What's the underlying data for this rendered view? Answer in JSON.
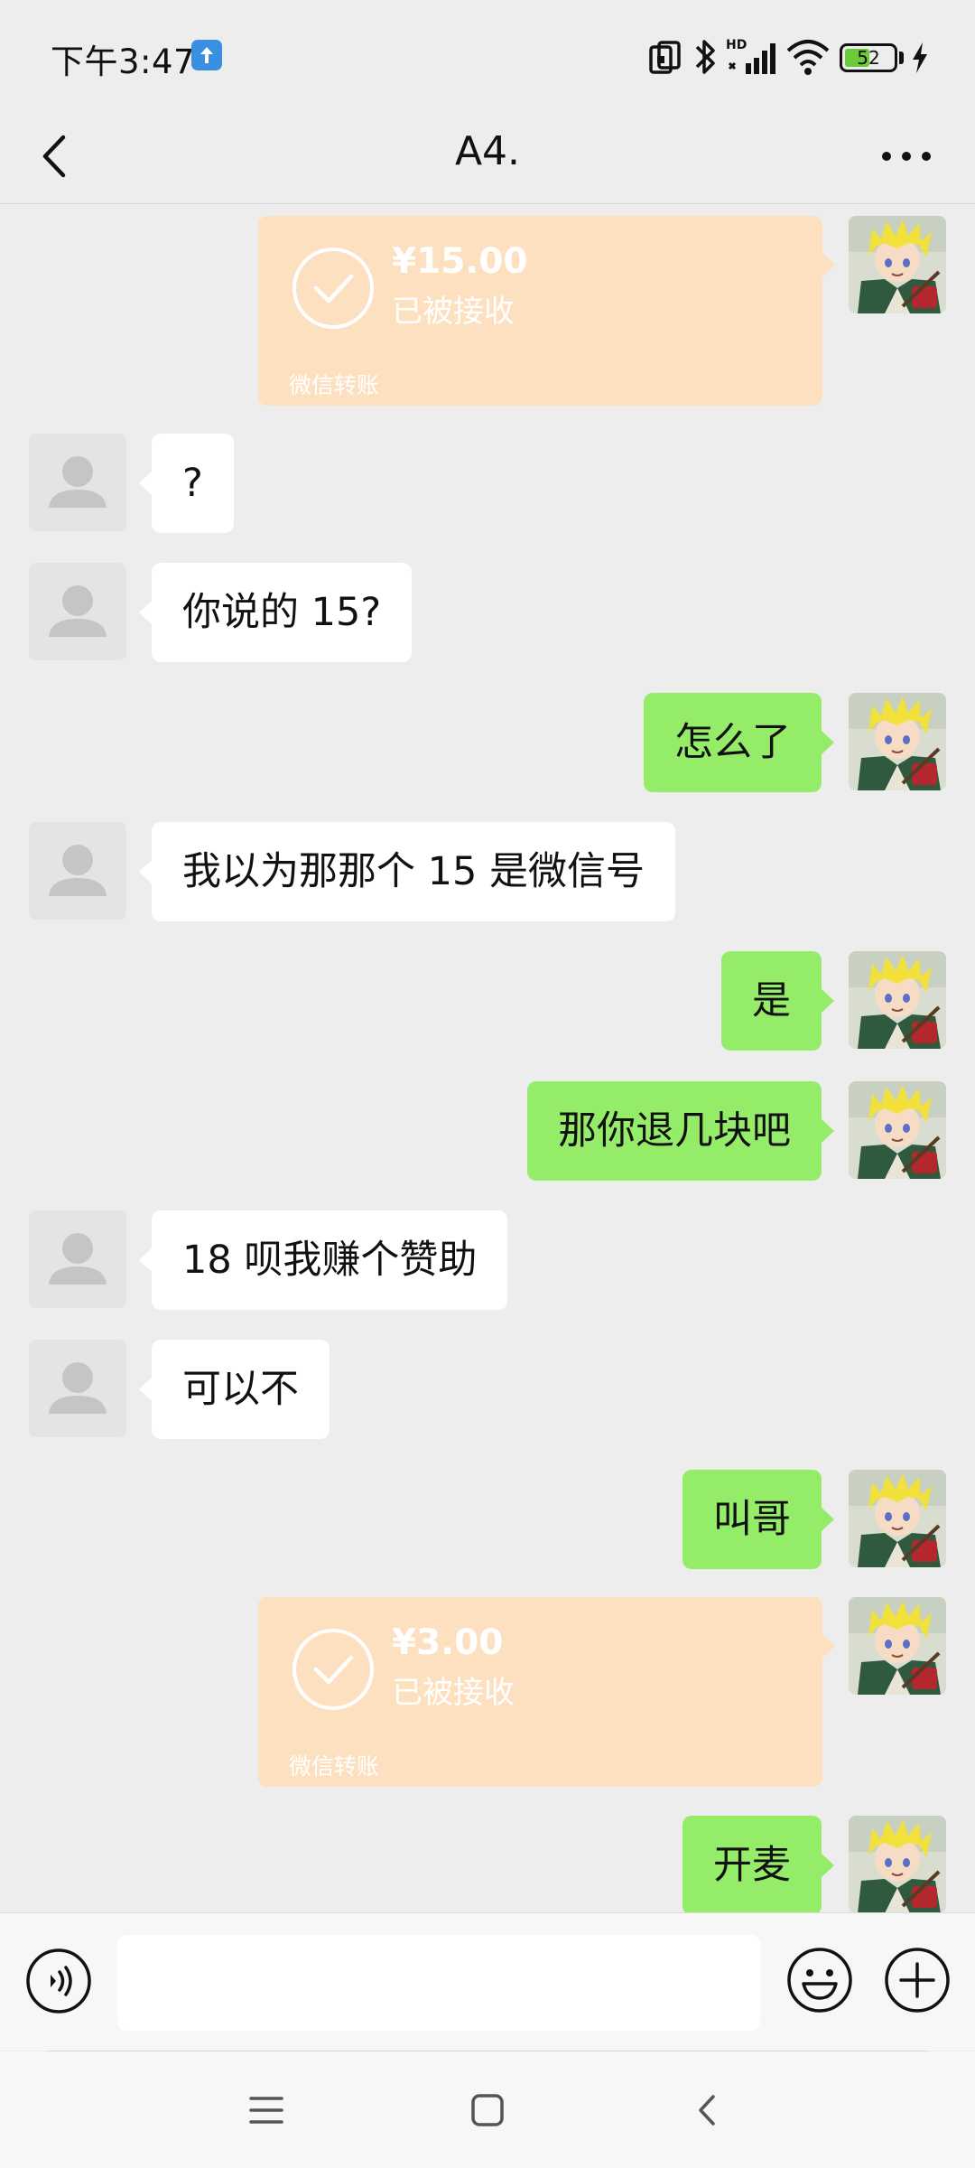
{
  "status_bar": {
    "time": "下午3:47",
    "battery": "52",
    "battery_level_percent": 52,
    "icons": [
      "upload-notification-icon",
      "nfc-icon",
      "bluetooth-icon",
      "hd-signal-icon",
      "wifi-icon",
      "battery-icon",
      "charging-icon"
    ]
  },
  "header": {
    "title": "A4.",
    "back_icon": "back-arrow-icon",
    "more_icon": "more-dots-icon"
  },
  "messages": [
    {
      "side": "right",
      "type": "transfer",
      "amount": "¥15.00",
      "status": "已被接收",
      "label": "微信转账"
    },
    {
      "side": "left",
      "type": "text",
      "text": "?"
    },
    {
      "side": "left",
      "type": "text",
      "text": "你说的 15?"
    },
    {
      "side": "right",
      "type": "text",
      "text": "怎么了"
    },
    {
      "side": "left",
      "type": "text",
      "text": "我以为那那个 15 是微信号"
    },
    {
      "side": "right",
      "type": "text",
      "text": "是"
    },
    {
      "side": "right",
      "type": "text",
      "text": "那你退几块吧"
    },
    {
      "side": "left",
      "type": "text",
      "text": "18 呗我赚个赞助"
    },
    {
      "side": "left",
      "type": "text",
      "text": "可以不"
    },
    {
      "side": "right",
      "type": "text",
      "text": "叫哥"
    },
    {
      "side": "right",
      "type": "transfer",
      "amount": "¥3.00",
      "status": "已被接收",
      "label": "微信转账"
    },
    {
      "side": "right",
      "type": "text",
      "text": "开麦"
    }
  ],
  "input_bar": {
    "value": "",
    "placeholder": "",
    "icons": [
      "voice-icon",
      "emoji-icon",
      "plus-icon"
    ]
  },
  "system_nav": {
    "icons": [
      "menu-icon",
      "home-icon",
      "back-icon"
    ]
  },
  "colors": {
    "background": "#ededed",
    "sent_bubble": "#95ec69",
    "received_bubble": "#ffffff",
    "transfer_card": "#fde0bf"
  }
}
